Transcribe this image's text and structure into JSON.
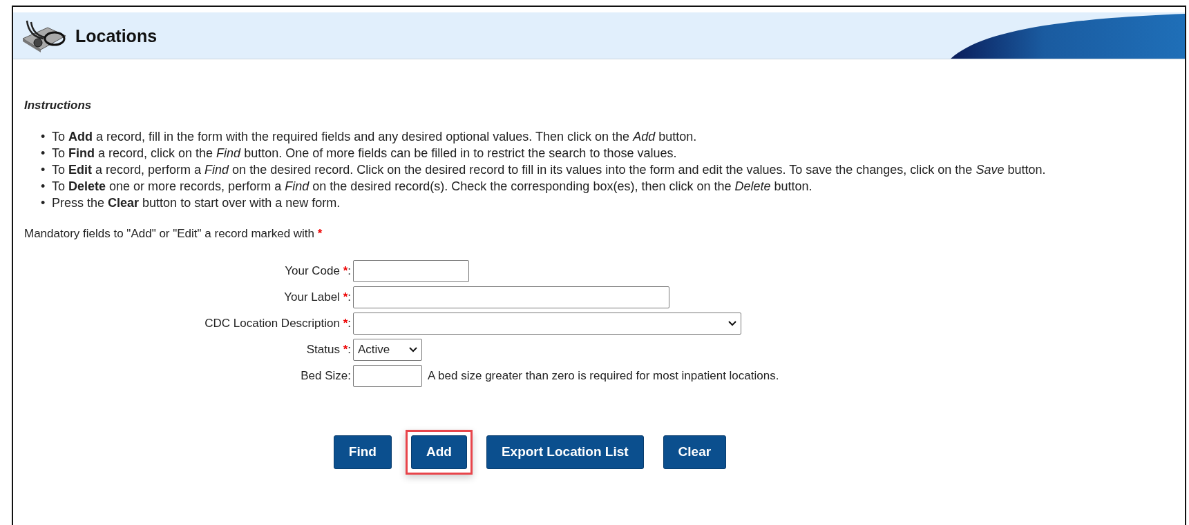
{
  "header": {
    "title": "Locations"
  },
  "instructions": {
    "title": "Instructions",
    "bullet": "•",
    "items": [
      "To **Add** a record, fill in the form with the required fields and any desired optional values. Then click on the *Add* button.",
      "To **Find** a record, click on the *Find* button. One of more fields can be filled in to restrict the search to those values.",
      "To **Edit** a record, perform a *Find* on the desired record. Click on the desired record to fill in its values into the form and edit the values. To save the changes, click on the *Save* button.",
      "To **Delete** one or more records, perform a *Find* on the desired record(s). Check the corresponding box(es), then click on the *Delete* button.",
      "Press the **Clear** button to start over with a new form."
    ]
  },
  "mandatory_note": {
    "text": "Mandatory fields to \"Add\" or \"Edit\" a record marked with",
    "marker": "*"
  },
  "label_suffix": ":",
  "fields": [
    {
      "label": "Your Code",
      "required": true,
      "kind": "text"
    },
    {
      "label": "Your Label",
      "required": true,
      "kind": "text"
    },
    {
      "label": "CDC Location Description",
      "required": true,
      "kind": "select"
    },
    {
      "label": "Status",
      "required": true,
      "kind": "select",
      "value": "Active"
    },
    {
      "label": "Bed Size",
      "required": false,
      "kind": "text",
      "hint": "A bed size greater than zero is required for most inpatient locations."
    }
  ],
  "buttons": [
    {
      "label": "Find",
      "highlighted": false
    },
    {
      "label": "Add",
      "highlighted": true
    },
    {
      "label": "Export Location List",
      "highlighted": false
    },
    {
      "label": "Clear",
      "highlighted": false
    }
  ]
}
